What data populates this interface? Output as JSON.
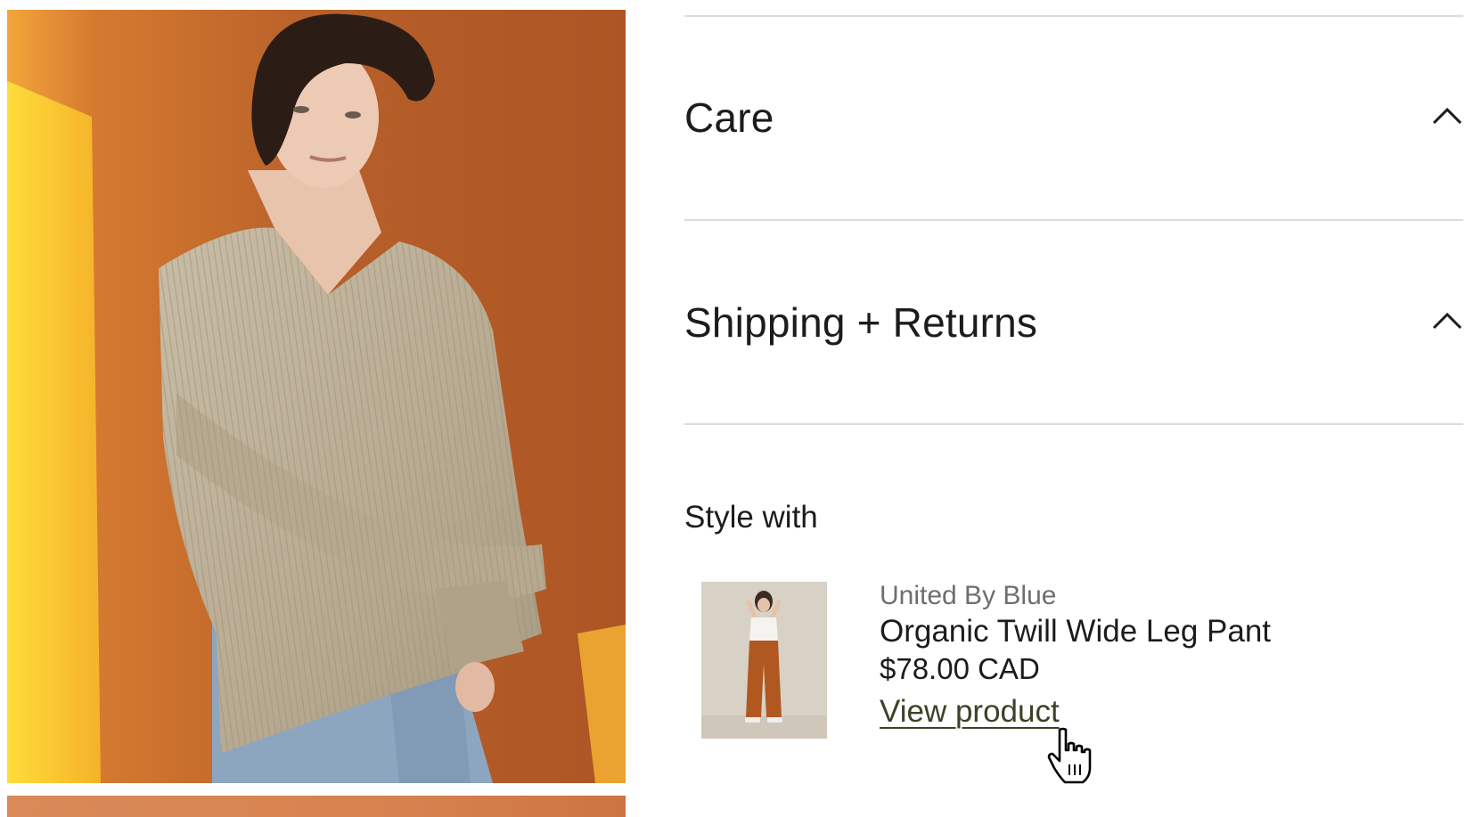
{
  "accordion": [
    {
      "title": "Care",
      "icon": "chevron-up-icon"
    },
    {
      "title": "Shipping + Returns",
      "icon": "chevron-up-icon"
    }
  ],
  "style_with": {
    "heading": "Style with",
    "product": {
      "brand": "United By Blue",
      "name": "Organic Twill Wide Leg Pant",
      "price": "$78.00 CAD",
      "link_label": "View product"
    }
  },
  "colors": {
    "link": "#3b4226",
    "divider": "#dcdcdc",
    "hero_background": "#b95f25",
    "sweater": "#bfb19a",
    "pants": "#b0581f"
  }
}
